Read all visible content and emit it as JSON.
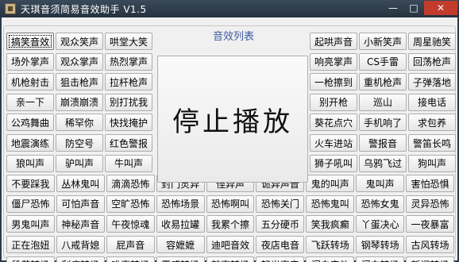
{
  "window": {
    "title": "天琪音须简易音效助手 V1.5",
    "minimize_glyph": "—",
    "maximize_glyph": "□",
    "close_glyph": "✕"
  },
  "group_title": "音效列表",
  "stop_label": "停止播放",
  "left_rows": [
    [
      "搞笑音效",
      "观众笑声",
      "哄堂大笑"
    ],
    [
      "场外掌声",
      "观众掌声",
      "热烈掌声"
    ],
    [
      "机枪射击",
      "狙击枪声",
      "拉杆枪声"
    ],
    [
      "亲一下",
      "崩溃崩溃",
      "别打扰我"
    ],
    [
      "公鸡舞曲",
      "稀罕你",
      "快找掩护"
    ],
    [
      "地震演练",
      "防空号",
      "红色警报"
    ],
    [
      "狼叫声",
      "驴叫声",
      "牛叫声"
    ]
  ],
  "right_rows": [
    [
      "起哄声音",
      "小新笑声",
      "周星驰笑"
    ],
    [
      "响亮掌声",
      "CS手雷",
      "回荡枪声"
    ],
    [
      "一枪擦到",
      "重机枪声",
      "子弹落地"
    ],
    [
      "别开枪",
      "巡山",
      "接电话"
    ],
    [
      "葵花点穴",
      "手机响了",
      "求包养"
    ],
    [
      "火车进站",
      "警报音",
      "警笛长鸣"
    ],
    [
      "狮子吼叫",
      "乌鸦飞过",
      "狗叫声"
    ]
  ],
  "bottom_rows": [
    [
      "不要踩我",
      "丛林鬼叫",
      "滴滴恐怖",
      "封门灵异",
      "怪异声",
      "诡异声音",
      "鬼的叫声",
      "鬼叫声",
      "害怕恐惧"
    ],
    [
      "僵尸恐怖",
      "可怕声音",
      "空旷恐怖",
      "恐怖场景",
      "恐怖啊叫",
      "恐怖关门",
      "恐怖鬼叫",
      "恐怖女鬼",
      "灵异恐怖"
    ],
    [
      "男鬼叫声",
      "神秘声音",
      "午夜惊魂",
      "收易拉罐",
      "我累个擦",
      "五分硬币",
      "笑我疯癫",
      "丫蛋决心",
      "一夜暴富"
    ],
    [
      "正在泡妞",
      "八戒背媳",
      "屁声音",
      "容嬷嬷",
      "迪吧音效",
      "夜店电音",
      "飞跃转场",
      "钢琴转场",
      "古风转场"
    ],
    [
      "段落转场",
      "刮痧转场",
      "唯声转场",
      "震感转场",
      "鼓声转场",
      "轻光声音",
      "闪白音效",
      "闪白转场",
      "新闻转场"
    ]
  ]
}
